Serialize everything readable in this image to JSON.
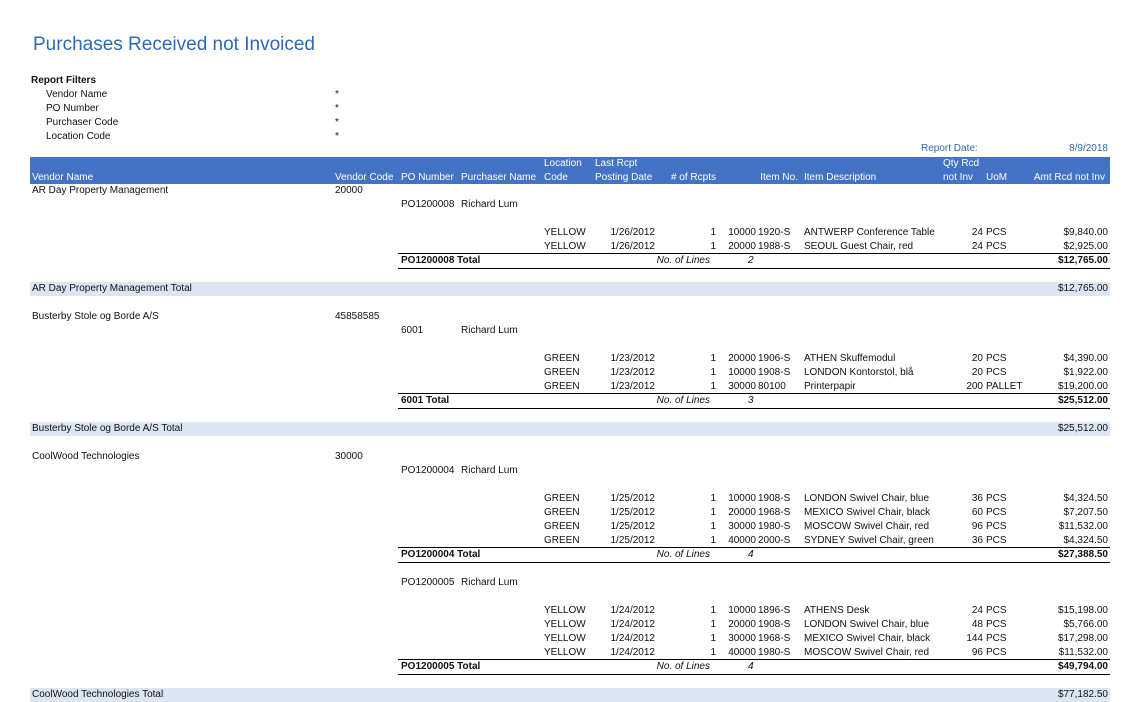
{
  "title": "Purchases Received not Invoiced",
  "filters": {
    "heading": "Report Filters",
    "items": [
      {
        "label": "Vendor Name",
        "value": "*"
      },
      {
        "label": "PO Number",
        "value": "*"
      },
      {
        "label": "Purchaser Code",
        "value": "*"
      },
      {
        "label": "Location Code",
        "value": "*"
      }
    ]
  },
  "report_date": {
    "label": "Report Date:",
    "value": "8/9/2018"
  },
  "colors": {
    "title": "#2e69b3",
    "header_bg": "#4472c4",
    "total_band": "#dce6f3"
  },
  "columns": {
    "vendor_name": "Vendor Name",
    "vendor_code": "Vendor Code",
    "po_number": "PO Number",
    "purchaser_name": "Purchaser Name",
    "location_top": "Location",
    "location_bottom": "Code",
    "last_rcpt_top": "Last Rcpt",
    "last_rcpt_bottom": "Posting Date",
    "num_rcpts": "# of Rcpts",
    "item_no": "Item No.",
    "item_desc": "Item Description",
    "qty_top": "Qty Rcd",
    "qty_bottom": "not Inv",
    "uom": "UoM",
    "amt": "Amt Rcd not Inv"
  },
  "vendors": [
    {
      "name": "AR Day Property Management",
      "code": "20000",
      "total_label": "AR Day Property Management Total",
      "total_amount": "$12,765.00",
      "pos": [
        {
          "po": "PO1200008",
          "purchaser": "Richard Lum",
          "lines": [
            {
              "loc": "YELLOW",
              "date": "1/26/2012",
              "rcpts": "1",
              "ln": "10000",
              "item": "1920-S",
              "desc": "ANTWERP Conference Table",
              "qty": "24",
              "uom": "PCS",
              "amt": "$9,840.00"
            },
            {
              "loc": "YELLOW",
              "date": "1/26/2012",
              "rcpts": "1",
              "ln": "20000",
              "item": "1988-S",
              "desc": "SEOUL Guest Chair, red",
              "qty": "24",
              "uom": "PCS",
              "amt": "$2,925.00"
            }
          ],
          "total_label": "PO1200008 Total",
          "lines_label": "No. of Lines",
          "line_count": "2",
          "total_amount": "$12,765.00"
        }
      ]
    },
    {
      "name": "Busterby Stole og Borde A/S",
      "code": "45858585",
      "total_label": "Busterby Stole og Borde A/S Total",
      "total_amount": "$25,512.00",
      "pos": [
        {
          "po": "6001",
          "purchaser": "Richard Lum",
          "lines": [
            {
              "loc": "GREEN",
              "date": "1/23/2012",
              "rcpts": "1",
              "ln": "20000",
              "item": "1906-S",
              "desc": "ATHEN Skuffemodul",
              "qty": "20",
              "uom": "PCS",
              "amt": "$4,390.00"
            },
            {
              "loc": "GREEN",
              "date": "1/23/2012",
              "rcpts": "1",
              "ln": "10000",
              "item": "1908-S",
              "desc": "LONDON Kontorstol, blå",
              "qty": "20",
              "uom": "PCS",
              "amt": "$1,922.00"
            },
            {
              "loc": "GREEN",
              "date": "1/23/2012",
              "rcpts": "1",
              "ln": "30000",
              "item": "80100",
              "desc": "Printerpapir",
              "qty": "200",
              "uom": "PALLET",
              "amt": "$19,200.00"
            }
          ],
          "total_label": "6001 Total",
          "lines_label": "No. of Lines",
          "line_count": "3",
          "total_amount": "$25,512.00"
        }
      ]
    },
    {
      "name": "CoolWood Technologies",
      "code": "30000",
      "total_label": "CoolWood Technologies Total",
      "total_amount": "$77,182.50",
      "pos": [
        {
          "po": "PO1200004",
          "purchaser": "Richard Lum",
          "lines": [
            {
              "loc": "GREEN",
              "date": "1/25/2012",
              "rcpts": "1",
              "ln": "10000",
              "item": "1908-S",
              "desc": "LONDON Swivel Chair, blue",
              "qty": "36",
              "uom": "PCS",
              "amt": "$4,324.50"
            },
            {
              "loc": "GREEN",
              "date": "1/25/2012",
              "rcpts": "1",
              "ln": "20000",
              "item": "1968-S",
              "desc": "MEXICO Swivel Chair, black",
              "qty": "60",
              "uom": "PCS",
              "amt": "$7,207.50"
            },
            {
              "loc": "GREEN",
              "date": "1/25/2012",
              "rcpts": "1",
              "ln": "30000",
              "item": "1980-S",
              "desc": "MOSCOW Swivel Chair, red",
              "qty": "96",
              "uom": "PCS",
              "amt": "$11,532.00"
            },
            {
              "loc": "GREEN",
              "date": "1/25/2012",
              "rcpts": "1",
              "ln": "40000",
              "item": "2000-S",
              "desc": "SYDNEY Swivel Chair, green",
              "qty": "36",
              "uom": "PCS",
              "amt": "$4,324.50"
            }
          ],
          "total_label": "PO1200004 Total",
          "lines_label": "No. of Lines",
          "line_count": "4",
          "total_amount": "$27,388.50"
        },
        {
          "po": "PO1200005",
          "purchaser": "Richard Lum",
          "lines": [
            {
              "loc": "YELLOW",
              "date": "1/24/2012",
              "rcpts": "1",
              "ln": "10000",
              "item": "1896-S",
              "desc": "ATHENS Desk",
              "qty": "24",
              "uom": "PCS",
              "amt": "$15,198.00"
            },
            {
              "loc": "YELLOW",
              "date": "1/24/2012",
              "rcpts": "1",
              "ln": "20000",
              "item": "1908-S",
              "desc": "LONDON Swivel Chair, blue",
              "qty": "48",
              "uom": "PCS",
              "amt": "$5,766.00"
            },
            {
              "loc": "YELLOW",
              "date": "1/24/2012",
              "rcpts": "1",
              "ln": "30000",
              "item": "1968-S",
              "desc": "MEXICO Swivel Chair, black",
              "qty": "144",
              "uom": "PCS",
              "amt": "$17,298.00"
            },
            {
              "loc": "YELLOW",
              "date": "1/24/2012",
              "rcpts": "1",
              "ln": "40000",
              "item": "1980-S",
              "desc": "MOSCOW Swivel Chair, red",
              "qty": "96",
              "uom": "PCS",
              "amt": "$11,532.00"
            }
          ],
          "total_label": "PO1200005 Total",
          "lines_label": "No. of Lines",
          "line_count": "4",
          "total_amount": "$49,794.00"
        }
      ]
    }
  ]
}
